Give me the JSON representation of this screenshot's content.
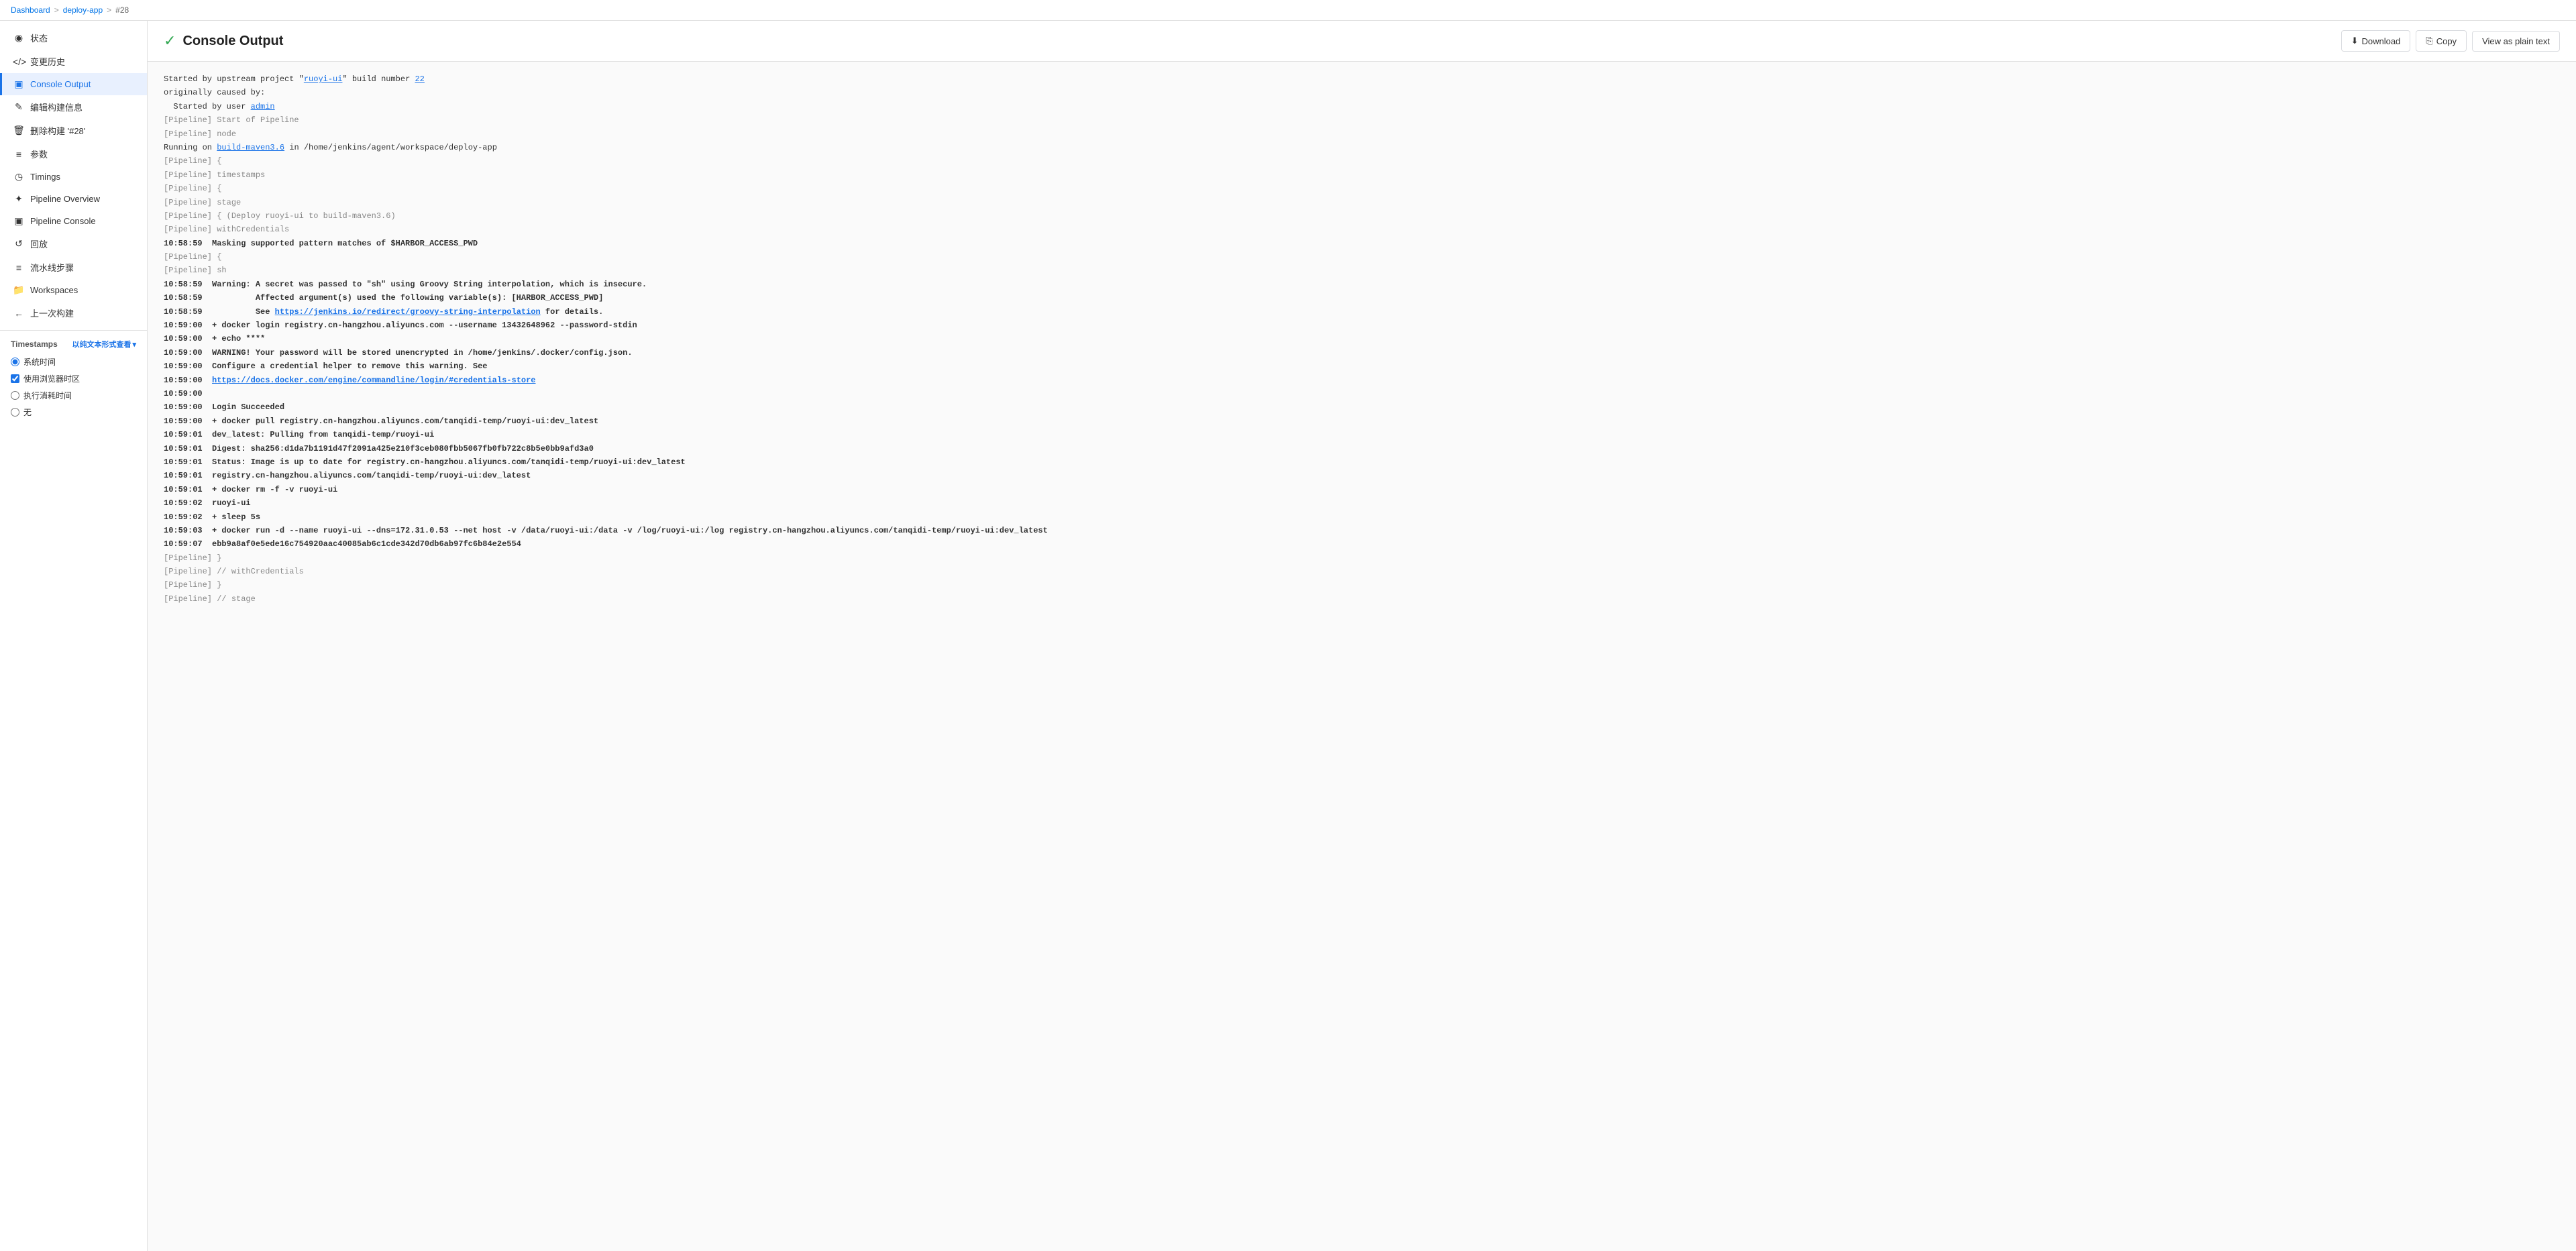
{
  "breadcrumb": {
    "items": [
      {
        "label": "Dashboard",
        "link": true
      },
      {
        "label": "deploy-app",
        "link": true
      },
      {
        "label": "#28",
        "link": false
      }
    ],
    "separators": [
      ">",
      ">"
    ]
  },
  "sidebar": {
    "items": [
      {
        "id": "status",
        "icon": "◉",
        "label": "状态"
      },
      {
        "id": "history",
        "icon": "</>",
        "label": "变更历史"
      },
      {
        "id": "console",
        "icon": "▣",
        "label": "Console Output",
        "active": true
      },
      {
        "id": "build-info",
        "icon": "✎",
        "label": "编辑构建信息"
      },
      {
        "id": "delete",
        "icon": "🗑",
        "label": "删除构建 '#28'"
      },
      {
        "id": "params",
        "icon": "≡",
        "label": "参数"
      },
      {
        "id": "timings",
        "icon": "◷",
        "label": "Timings"
      },
      {
        "id": "pipeline-overview",
        "icon": "✦",
        "label": "Pipeline Overview"
      },
      {
        "id": "pipeline-console",
        "icon": "▣",
        "label": "Pipeline Console"
      },
      {
        "id": "replay",
        "icon": "↺",
        "label": "回放"
      },
      {
        "id": "pipeline-steps",
        "icon": "≡",
        "label": "流水线步骤"
      },
      {
        "id": "workspaces",
        "icon": "📁",
        "label": "Workspaces"
      },
      {
        "id": "prev-build",
        "icon": "←",
        "label": "上一次构建"
      }
    ]
  },
  "timestamps": {
    "label": "Timestamps",
    "link_label": "以纯文本形式查看",
    "options": [
      {
        "id": "system-time",
        "label": "系统时间",
        "type": "radio",
        "checked": true
      },
      {
        "id": "browser-time",
        "label": "使用浏览器时区",
        "type": "checkbox",
        "checked": true
      },
      {
        "id": "elapsed",
        "label": "执行消耗时间",
        "type": "radio",
        "checked": false
      },
      {
        "id": "none",
        "label": "无",
        "type": "radio",
        "checked": false
      }
    ]
  },
  "header": {
    "title": "Console Output",
    "success_icon": "✓",
    "actions": [
      {
        "id": "download",
        "icon": "⬇",
        "label": "Download"
      },
      {
        "id": "copy",
        "icon": "⎘",
        "label": "Copy"
      },
      {
        "id": "plain-text",
        "label": "View as plain text"
      }
    ]
  },
  "console": {
    "lines": [
      {
        "type": "normal",
        "text": "Started by upstream project \"ruoyi-ui\" build number 22",
        "link_parts": [
          {
            "text": "ruoyi-ui",
            "url": "#"
          },
          {
            "text": "22",
            "url": "#"
          }
        ]
      },
      {
        "type": "normal",
        "text": "originally caused by:"
      },
      {
        "type": "normal",
        "text": "  Started by user admin",
        "link_parts": [
          {
            "text": "admin",
            "url": "#"
          }
        ]
      },
      {
        "type": "muted",
        "text": "[Pipeline] Start of Pipeline"
      },
      {
        "type": "muted",
        "text": "[Pipeline] node"
      },
      {
        "type": "normal",
        "text": "Running on build-maven3.6 in /home/jenkins/agent/workspace/deploy-app",
        "link_parts": [
          {
            "text": "build-maven3.6",
            "url": "#"
          }
        ]
      },
      {
        "type": "muted",
        "text": "[Pipeline] {"
      },
      {
        "type": "muted",
        "text": "[Pipeline] timestamps"
      },
      {
        "type": "muted",
        "text": "[Pipeline] {"
      },
      {
        "type": "muted",
        "text": "[Pipeline] stage"
      },
      {
        "type": "muted",
        "text": "[Pipeline] { (Deploy ruoyi-ui to build-maven3.6)"
      },
      {
        "type": "muted",
        "text": "[Pipeline] withCredentials"
      },
      {
        "type": "bold",
        "text": "10:58:59  Masking supported pattern matches of $HARBOR_ACCESS_PWD"
      },
      {
        "type": "muted",
        "text": "[Pipeline] {"
      },
      {
        "type": "muted",
        "text": "[Pipeline] sh"
      },
      {
        "type": "bold",
        "text": "10:58:59  Warning: A secret was passed to \"sh\" using Groovy String interpolation, which is insecure."
      },
      {
        "type": "bold",
        "text": "10:58:59           Affected argument(s) used the following variable(s): [HARBOR_ACCESS_PWD]"
      },
      {
        "type": "bold_link",
        "text": "10:58:59           See https://jenkins.io/redirect/groovy-string-interpolation for details.",
        "link_text": "https://jenkins.io/redirect/groovy-string-interpolation",
        "url": "#"
      },
      {
        "type": "bold",
        "text": "10:59:00  + docker login registry.cn-hangzhou.aliyuncs.com --username 13432648962 --password-stdin"
      },
      {
        "type": "bold",
        "text": "10:59:00  + echo ****"
      },
      {
        "type": "bold",
        "text": "10:59:00  WARNING! Your password will be stored unencrypted in /home/jenkins/.docker/config.json."
      },
      {
        "type": "bold",
        "text": "10:59:00  Configure a credential helper to remove this warning. See"
      },
      {
        "type": "bold_link",
        "text": "10:59:00  https://docs.docker.com/engine/commandline/login/#credentials-store",
        "link_text": "https://docs.docker.com/engine/commandline/login/#credentials-store",
        "url": "#"
      },
      {
        "type": "bold",
        "text": "10:59:00  "
      },
      {
        "type": "bold",
        "text": "10:59:00  Login Succeeded"
      },
      {
        "type": "bold",
        "text": "10:59:00  + docker pull registry.cn-hangzhou.aliyuncs.com/tanqidi-temp/ruoyi-ui:dev_latest"
      },
      {
        "type": "bold",
        "text": "10:59:01  dev_latest: Pulling from tanqidi-temp/ruoyi-ui"
      },
      {
        "type": "bold",
        "text": "10:59:01  Digest: sha256:d1da7b1191d47f2091a425e210f3ceb080fbb5067fb0fb722c8b5e0bb9afd3a0"
      },
      {
        "type": "bold",
        "text": "10:59:01  Status: Image is up to date for registry.cn-hangzhou.aliyuncs.com/tanqidi-temp/ruoyi-ui:dev_latest"
      },
      {
        "type": "bold",
        "text": "10:59:01  registry.cn-hangzhou.aliyuncs.com/tanqidi-temp/ruoyi-ui:dev_latest"
      },
      {
        "type": "bold",
        "text": "10:59:01  + docker rm -f -v ruoyi-ui"
      },
      {
        "type": "bold",
        "text": "10:59:02  ruoyi-ui"
      },
      {
        "type": "bold",
        "text": "10:59:02  + sleep 5s"
      },
      {
        "type": "bold",
        "text": "10:59:03  + docker run -d --name ruoyi-ui --dns=172.31.0.53 --net host -v /data/ruoyi-ui:/data -v /log/ruoyi-ui:/log registry.cn-hangzhou.aliyuncs.com/tanqidi-temp/ruoyi-ui:dev_latest"
      },
      {
        "type": "bold",
        "text": "10:59:07  ebb9a8af0e5ede16c754920aac40085ab6c1cde342d70db6ab97fc6b84e2e554"
      },
      {
        "type": "muted",
        "text": "[Pipeline] }"
      },
      {
        "type": "muted",
        "text": "[Pipeline] // withCredentials"
      },
      {
        "type": "muted",
        "text": "[Pipeline] }"
      },
      {
        "type": "muted",
        "text": "[Pipeline] // stage"
      }
    ]
  }
}
